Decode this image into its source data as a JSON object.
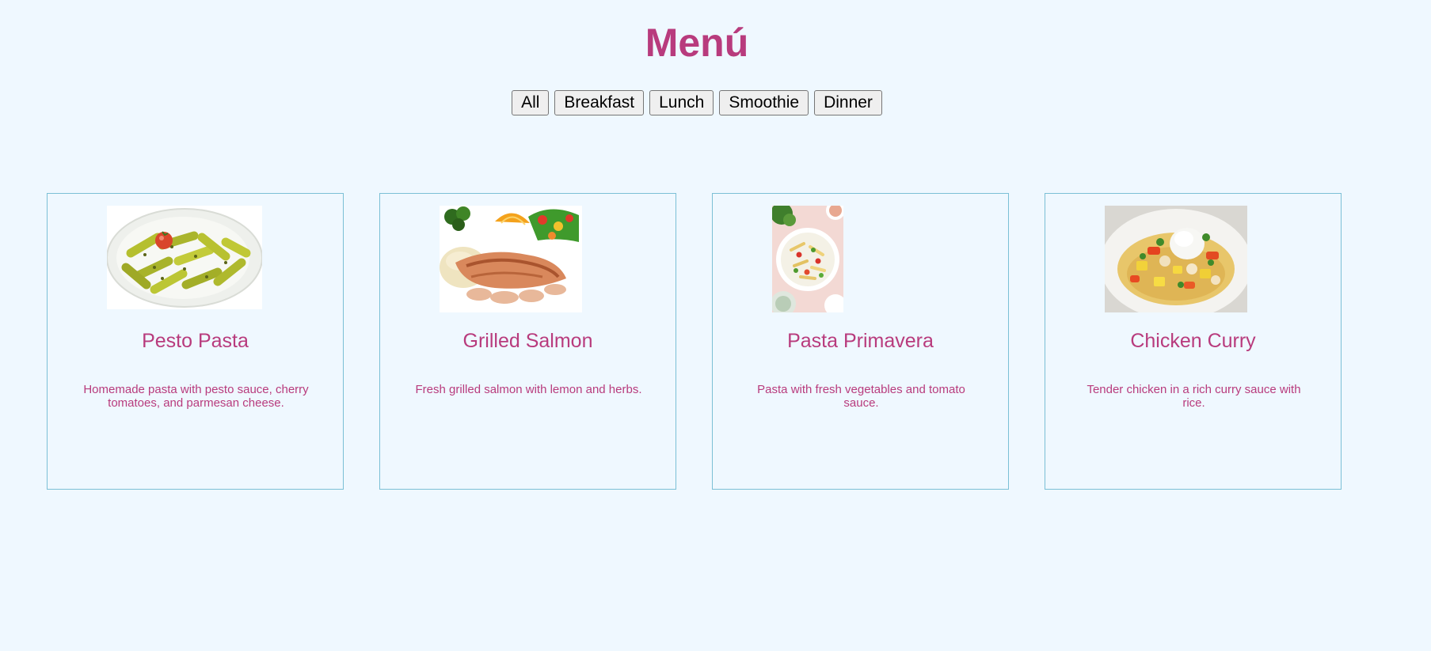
{
  "page": {
    "title": "Menú",
    "accent_color": "#b83b7d",
    "background_color": "#eff8ff",
    "card_border_color": "#7bbfd6"
  },
  "filters": [
    {
      "label": "All"
    },
    {
      "label": "Breakfast"
    },
    {
      "label": "Lunch"
    },
    {
      "label": "Smoothie"
    },
    {
      "label": "Dinner"
    }
  ],
  "menu_items": [
    {
      "title": "Pesto Pasta",
      "description": "Homemade pasta with pesto sauce, cherry tomatoes, and parmesan cheese.",
      "image": "pesto-pasta-photo"
    },
    {
      "title": "Grilled Salmon",
      "description": "Fresh grilled salmon with lemon and herbs.",
      "image": "grilled-salmon-photo"
    },
    {
      "title": "Pasta Primavera",
      "description": "Pasta with fresh vegetables and tomato sauce.",
      "image": "pasta-primavera-photo"
    },
    {
      "title": "Chicken Curry",
      "description": "Tender chicken in a rich curry sauce with rice.",
      "image": "chicken-curry-photo"
    }
  ]
}
